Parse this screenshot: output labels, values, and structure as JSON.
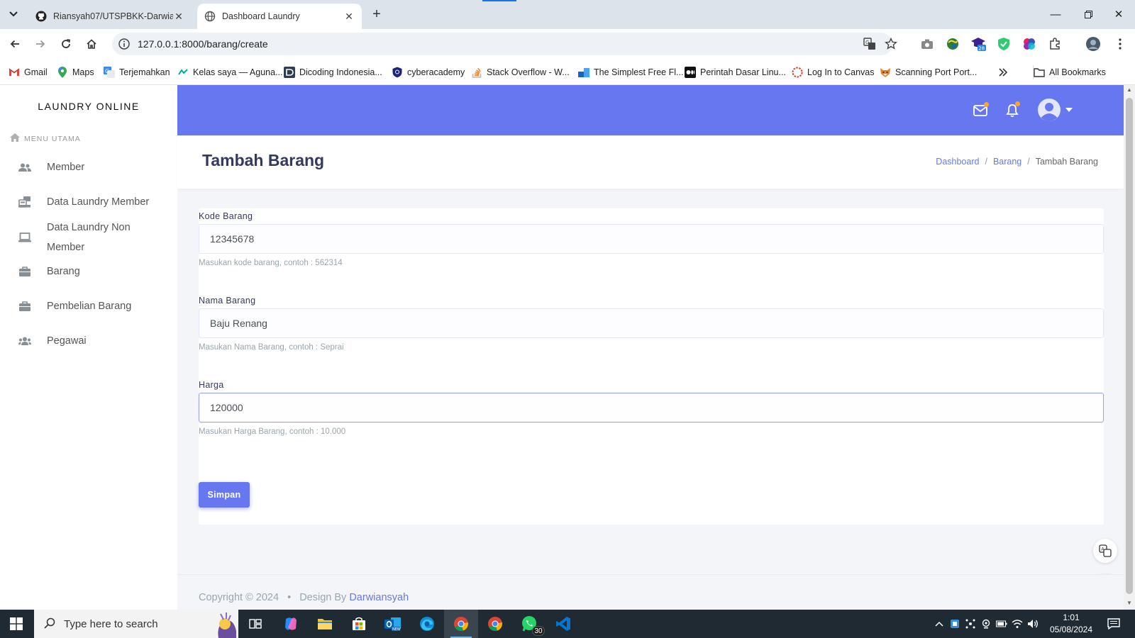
{
  "browser": {
    "tabs": [
      {
        "title": "Riansyah07/UTSPBKK-Darwiansyah",
        "icon": "github-icon",
        "active": false
      },
      {
        "title": "Dashboard Laundry",
        "icon": "globe-icon",
        "active": true
      }
    ],
    "url": "127.0.0.1:8000/barang/create",
    "bookmarks": [
      {
        "label": "Gmail",
        "icon": "gmail-icon"
      },
      {
        "label": "Maps",
        "icon": "maps-icon"
      },
      {
        "label": "Terjemahkan",
        "icon": "translate-icon"
      },
      {
        "label": "Kelas saya — Aguna...",
        "icon": "kelas-icon"
      },
      {
        "label": "Dicoding Indonesia...",
        "icon": "dicoding-icon"
      },
      {
        "label": "cyberacademy",
        "icon": "shield-icon"
      },
      {
        "label": "Stack Overflow - W...",
        "icon": "stackoverflow-icon"
      },
      {
        "label": "The Simplest Free Fl...",
        "icon": "flowchart-icon"
      },
      {
        "label": "Perintah Dasar Linu...",
        "icon": "medium-icon"
      },
      {
        "label": "Log In to Canvas",
        "icon": "canvas-icon"
      },
      {
        "label": "Scanning Port Port...",
        "icon": "fox-icon"
      }
    ],
    "all_bookmarks": "All Bookmarks"
  },
  "sidebar": {
    "brand": "LAUNDRY ONLINE",
    "menu_header": "MENU UTAMA",
    "items": [
      {
        "label": "Member",
        "icon": "users-icon"
      },
      {
        "label": "Data Laundry Member",
        "icon": "cash-register-icon"
      },
      {
        "label": "Data Laundry Non Member",
        "icon": "laptop-icon"
      },
      {
        "label": "Barang",
        "icon": "briefcase-icon"
      },
      {
        "label": "Pembelian Barang",
        "icon": "briefcase-icon"
      },
      {
        "label": "Pegawai",
        "icon": "group-icon"
      }
    ]
  },
  "header": {
    "title": "Tambah Barang",
    "breadcrumb": [
      "Dashboard",
      "Barang",
      "Tambah Barang"
    ]
  },
  "form": {
    "kode": {
      "label": "Kode Barang",
      "value": "12345678",
      "help": "Masukan kode barang, contoh : 562314"
    },
    "nama": {
      "label": "Nama Barang",
      "value": "Baju Renang",
      "help": "Masukan Nama Barang, contoh : Seprai"
    },
    "harga": {
      "label": "Harga",
      "value": "120000",
      "help": "Masukan Harga Barang, contoh : 10.000"
    },
    "submit_label": "Simpan"
  },
  "footer": {
    "copyright": "Copyright © 2024",
    "bullet": "•",
    "design_by": "Design By",
    "author": "Darwiansyah"
  },
  "taskbar": {
    "search_placeholder": "Type here to search",
    "whatsapp_badge": "30",
    "time": "1:01",
    "date": "05/08/2024"
  },
  "colors": {
    "primary": "#6777ef",
    "topbar": "#6777ef",
    "notification_dot": "#ffa426"
  }
}
